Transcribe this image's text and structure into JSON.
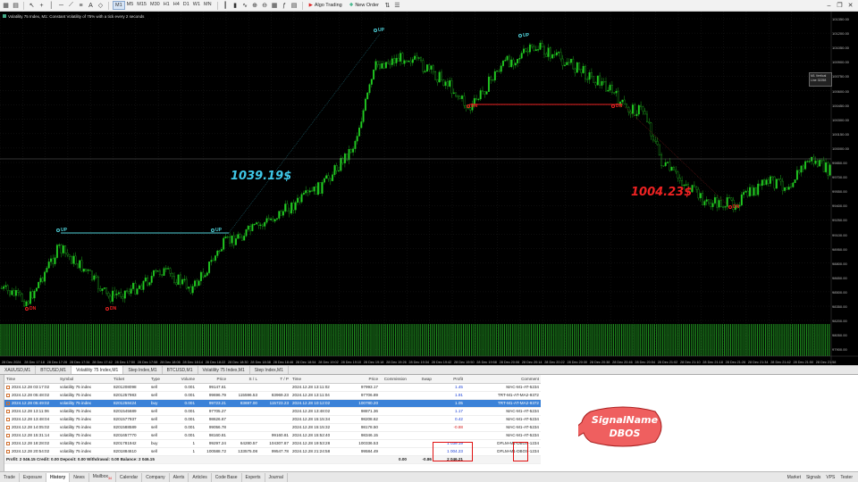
{
  "toolbar": {
    "timeframes": [
      "M1",
      "M5",
      "M15",
      "M30",
      "H1",
      "H4",
      "D1",
      "W1",
      "MN"
    ],
    "active_timeframe": "M1",
    "algo_trading": "Algo Trading",
    "new_order": "New Order"
  },
  "chart": {
    "title": "Volatility 75 Index, M1: Constant Volatility of 75% with a tick every 2 seconds",
    "vertical_line_label": "M1 Vertical Line 32258",
    "vertical_line_value": "",
    "price_labels": [
      "101350.00",
      "101200.00",
      "101050.00",
      "100900.00",
      "100750.00",
      "100600.00",
      "100450.00",
      "100300.00",
      "100150.00",
      "100000.00",
      "99850.00",
      "99700.00",
      "99550.00",
      "99400.00",
      "99250.00",
      "99100.00",
      "98950.00",
      "98800.00",
      "98650.00",
      "98500.00",
      "98350.00",
      "98200.00",
      "98050.00",
      "97900.00"
    ],
    "time_labels": [
      "28 Dec 2024",
      "28 Dec 17:18",
      "28 Dec 17:26",
      "28 Dec 17:34",
      "28 Dec 17:42",
      "28 Dec 17:50",
      "28 Dec 17:58",
      "28 Dec 18:06",
      "28 Dec 18:14",
      "28 Dec 18:22",
      "28 Dec 18:30",
      "28 Dec 18:38",
      "28 Dec 18:46",
      "28 Dec 18:54",
      "28 Dec 19:02",
      "28 Dec 19:10",
      "28 Dec 19:18",
      "28 Dec 19:26",
      "28 Dec 19:34",
      "28 Dec 19:42",
      "28 Dec 19:50",
      "28 Dec 19:58",
      "28 Dec 20:06",
      "28 Dec 20:14",
      "28 Dec 20:22",
      "28 Dec 20:30",
      "28 Dec 20:38",
      "28 Dec 20:46",
      "28 Dec 20:54",
      "28 Dec 21:02",
      "28 Dec 21:10",
      "28 Dec 21:18",
      "28 Dec 21:26",
      "28 Dec 21:34",
      "28 Dec 21:42",
      "28 Dec 21:50",
      "28 Dec 21:58"
    ],
    "profit_up_label": "1039.19$",
    "profit_down_label": "1004.23$",
    "signal_up": "UP",
    "signal_dn": "DN",
    "colors": {
      "bull": "#22cc22",
      "up_signal": "#4fd1d9",
      "dn_signal": "#ee2222",
      "profit_up": "#3fc8e8",
      "profit_down": "#ee2222"
    }
  },
  "chart_tabs": [
    "XAUUSD,M1",
    "BTCUSD,M1",
    "Volatility 75 Index,M1",
    "Step Index,M1",
    "BTCUSD,M1",
    "Volatility 75 Index,M1",
    "Step Index,M1"
  ],
  "active_chart_tab": 2,
  "history": {
    "columns": [
      "Time",
      "Symbol",
      "Ticket",
      "Type",
      "Volume",
      "Price",
      "S / L",
      "T / P",
      "Time",
      "Price",
      "Commission",
      "Swap",
      "Profit",
      "Comment"
    ],
    "rows": [
      [
        "2024.12.28 03:17:02",
        "volatility 75 index",
        "8201208098",
        "sell",
        "0.001",
        "99147.61",
        "",
        "",
        "2024.12.28 13:11:02",
        "97993.17",
        "",
        "",
        "1.45",
        "MAC-M1-AT-5234"
      ],
      [
        "2024.12.28 05:48:02",
        "volatility 75 index",
        "8201257983",
        "sell",
        "0.001",
        "99696.79",
        "115596.53",
        "83969.23",
        "2024.12.28 13:11:04",
        "97706.89",
        "",
        "",
        "1.91",
        "TRT-M1-AT-MA2-9372"
      ],
      [
        "2024.12.28 05:49:02",
        "volatility 75 index",
        "8201258424",
        "buy",
        "0.001",
        "99723.21",
        "83697.00",
        "115723.23",
        "2024.12.28 10:12:02",
        "100780.20",
        "",
        "",
        "1.05",
        "TRT-M1-AT-MA2-9372"
      ],
      [
        "2024.12.28 13:11:06",
        "volatility 75 index",
        "8201545689",
        "sell",
        "0.001",
        "97705.27",
        "",
        "",
        "2024.12.28 13:48:02",
        "98871.36",
        "",
        "",
        "1.17",
        "MAC-M1-AT-5234"
      ],
      [
        "2024.12.28 13:48:04",
        "volatility 75 index",
        "8201577937",
        "sell",
        "0.001",
        "98626.67",
        "",
        "",
        "2024.12.28 15:15:34",
        "98208.62",
        "",
        "",
        "0.42",
        "MAC-M1-AT-5234"
      ],
      [
        "2024.12.28 14:05:02",
        "volatility 75 index",
        "8201588589",
        "sell",
        "0.001",
        "99056.78",
        "",
        "",
        "2024.12.28 15:15:32",
        "98178.50",
        "",
        "",
        "-0.88",
        "MAC-M1-AT-5234"
      ],
      [
        "2024.12.28 15:31:14",
        "volatility 75 index",
        "8201657770",
        "sell",
        "0.001",
        "98160.81",
        "",
        "99160.81",
        "2024.12.28 15:52:40",
        "98346.15",
        "",
        "",
        "",
        "MAC-M1-AT-5234"
      ],
      [
        "2024.12.28 18:28:02",
        "volatility 75 index",
        "8201781942",
        "buy",
        "1",
        "99297.24",
        "64280.57",
        "104307.87",
        "2024.12.28 19:53:28",
        "100336.53",
        "",
        "",
        "1 039.19",
        "DFLM-M1-DBOS-1234"
      ],
      [
        "2024.12.28 20:54:02",
        "volatility 75 index",
        "8201884610",
        "sell",
        "1",
        "100588.72",
        "133575.08",
        "99547.78",
        "2024.12.28 21:24:58",
        "99584.49",
        "",
        "",
        "1 004.23",
        "DFLM-M1-DBOS-1234"
      ]
    ],
    "selected_row": 2,
    "total": {
      "summary": "Profit: 2 046.15  Credit: 0.00  Deposit: 0.00  Withdrawal: 0.00  Balance: 2 046.15",
      "commission": "0.00",
      "swap": "-0.86",
      "profit": "2 046.21"
    }
  },
  "callout": {
    "line1": "SignalName",
    "line2": "DBOS"
  },
  "bottom_tabs": [
    "Trade",
    "Exposure",
    "History",
    "News",
    "Mailbox",
    "Calendar",
    "Company",
    "Alerts",
    "Articles",
    "Code Base",
    "Experts",
    "Journal"
  ],
  "mailbox_badge": "34",
  "active_bottom_tab": "History",
  "bottom_right": [
    "Market",
    "Signals",
    "VPS",
    "Tester"
  ]
}
